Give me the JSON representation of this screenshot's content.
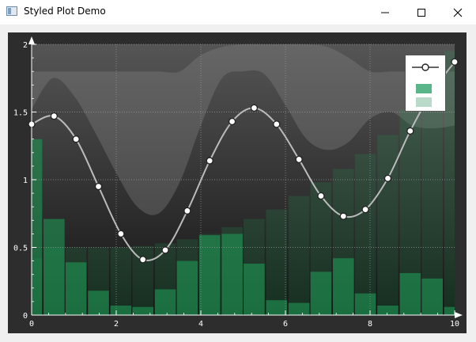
{
  "window": {
    "title": "Styled Plot Demo",
    "minimize_icon": "minimize-icon",
    "maximize_icon": "maximize-icon",
    "close_icon": "close-icon"
  },
  "chart_data": {
    "type": "line",
    "title": "",
    "xlabel": "",
    "ylabel": "",
    "xlim": [
      0,
      10
    ],
    "ylim": [
      0,
      2
    ],
    "grid": true,
    "legend_placement": "top-right",
    "x_ticks": [
      "0",
      "2",
      "4",
      "6",
      "8",
      "10"
    ],
    "y_ticks": [
      "0",
      "0.5",
      "1",
      "1.5",
      "2"
    ],
    "series": [
      {
        "kind": "line",
        "color": "#bbbbbb",
        "marker": "circle",
        "x": [
          0,
          0.53,
          1.05,
          1.58,
          2.11,
          2.63,
          3.16,
          3.68,
          4.21,
          4.74,
          5.26,
          5.79,
          6.32,
          6.84,
          7.37,
          7.89,
          8.42,
          8.95,
          9.47,
          10
        ],
        "y": [
          1.41,
          1.47,
          1.3,
          0.95,
          0.6,
          0.41,
          0.48,
          0.77,
          1.14,
          1.43,
          1.53,
          1.41,
          1.15,
          0.88,
          0.73,
          0.78,
          1.01,
          1.36,
          1.65,
          1.87
        ]
      },
      {
        "kind": "bar",
        "color": "#1f9a55",
        "x": [
          0,
          0.53,
          1.05,
          1.58,
          2.11,
          2.63,
          3.16,
          3.68,
          4.21,
          4.74,
          5.26,
          5.79,
          6.32,
          6.84,
          7.37,
          7.89,
          8.42,
          8.95,
          9.47,
          10
        ],
        "values": [
          1.3,
          0.71,
          0.39,
          0.18,
          0.07,
          0.06,
          0.19,
          0.4,
          0.59,
          0.6,
          0.38,
          0.11,
          0.09,
          0.32,
          0.42,
          0.16,
          0.07,
          0.31,
          0.27,
          0.06
        ]
      },
      {
        "kind": "bar",
        "color": "#1f9a55",
        "x": [
          0,
          0.53,
          1.05,
          1.58,
          2.11,
          2.63,
          3.16,
          3.68,
          4.21,
          4.74,
          5.26,
          5.79,
          6.32,
          6.84,
          7.37,
          7.89,
          8.42,
          8.95,
          9.47,
          10
        ],
        "values": [
          0.42,
          0.5,
          0.5,
          0.5,
          0.5,
          0.51,
          0.53,
          0.56,
          0.6,
          0.65,
          0.71,
          0.78,
          0.88,
          0.98,
          1.08,
          1.19,
          1.33,
          1.52,
          1.72,
          1.95
        ]
      },
      {
        "kind": "band",
        "color": "#888888",
        "x": [
          0,
          0.5,
          1,
          1.5,
          2,
          2.5,
          3,
          3.5,
          4,
          4.5,
          5,
          5.5,
          6,
          6.5,
          7,
          7.5,
          8,
          8.5,
          9,
          9.5,
          10
        ],
        "upper": [
          1.8,
          1.8,
          1.8,
          1.8,
          1.8,
          1.8,
          1.8,
          1.8,
          1.92,
          1.98,
          2.0,
          2.0,
          2.0,
          2.0,
          1.98,
          1.9,
          1.8,
          1.8,
          1.8,
          1.8,
          1.8
        ],
        "lower": [
          1.52,
          1.75,
          1.62,
          1.35,
          1.05,
          0.8,
          0.75,
          0.98,
          1.4,
          1.75,
          1.8,
          1.78,
          1.55,
          1.3,
          1.22,
          1.28,
          1.45,
          1.5,
          1.4,
          1.38,
          1.4
        ]
      }
    ]
  }
}
